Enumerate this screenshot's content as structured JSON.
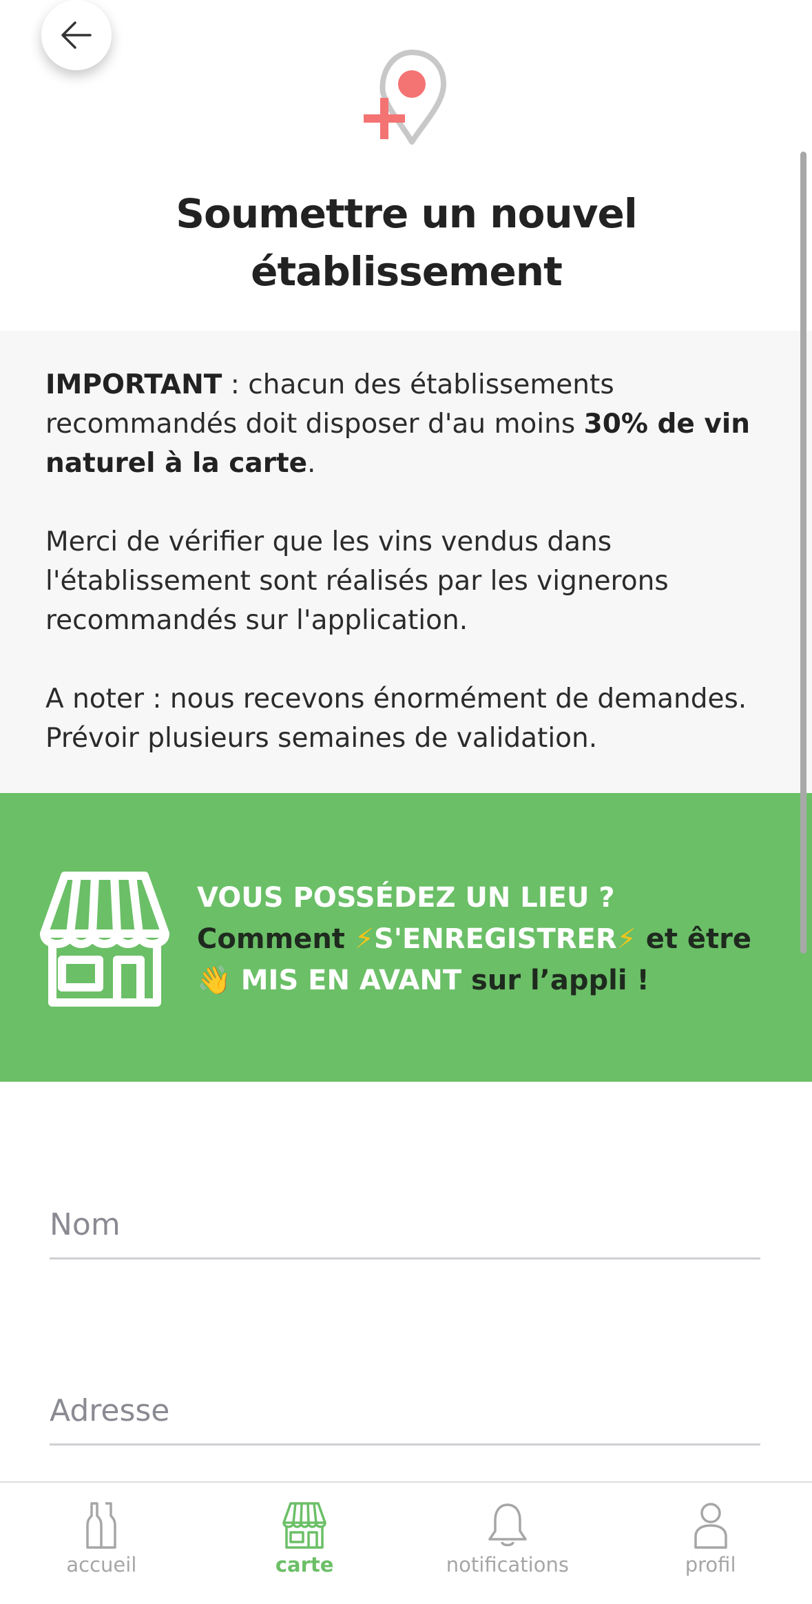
{
  "header": {
    "title": "Soumettre un nouvel établissement",
    "icon": "map-pin-plus-icon"
  },
  "info": {
    "p1_strong": "IMPORTANT",
    "p1_text": " : chacun des établissements recommandés doit disposer d'au moins ",
    "p1_bold2": "30% de vin naturel à la carte",
    "p1_end": ".",
    "p2": "Merci de vérifier que les vins vendus dans l'établissement sont réalisés par les vignerons recommandés sur l'application.",
    "p3": "A noter : nous recevons énormément de demandes. Prévoir plusieurs semaines de validation."
  },
  "banner": {
    "line1": "VOUS POSSÉDEZ UN LIEU ?",
    "comment": "Comment ",
    "register": "S'ENREGISTRER",
    "et_etre": " et être",
    "highlight": "MIS EN AVANT",
    "sur_appli": " sur l’appli !",
    "bolt": "⚡",
    "wave": "👋",
    "color": "#6bbf67"
  },
  "form": {
    "name_placeholder": "Nom",
    "address_placeholder": "Adresse"
  },
  "tabbar": {
    "items": [
      {
        "label": "accueil",
        "icon": "bottles-icon"
      },
      {
        "label": "carte",
        "icon": "shop-icon",
        "active": true
      },
      {
        "label": "notifications",
        "icon": "bell-icon"
      },
      {
        "label": "profil",
        "icon": "user-icon"
      }
    ],
    "active_color": "#6bbf67",
    "inactive_color": "#a6a6a6"
  }
}
